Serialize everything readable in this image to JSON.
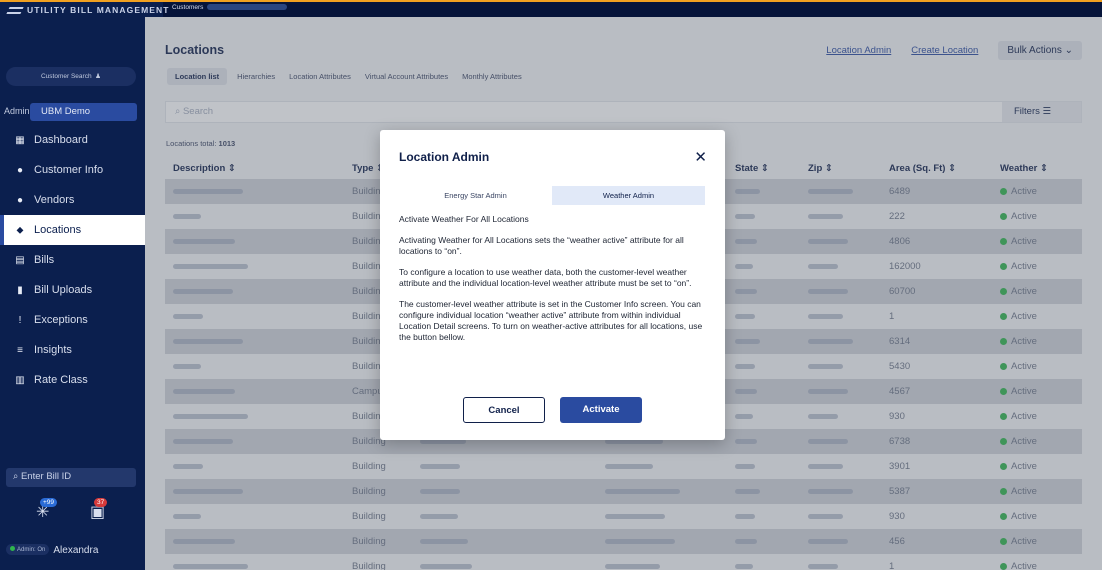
{
  "app": {
    "brand": "UTILITY BILL MANAGEMENT",
    "breadcrumb_root": "Customers"
  },
  "sidebar": {
    "customer_search": "Customer Search",
    "admin_label": "Admin",
    "customer_name": "UBM Demo",
    "items": [
      {
        "label": "Dashboard",
        "icon": "dashboard-icon",
        "glyph": "▦"
      },
      {
        "label": "Customer Info",
        "icon": "person-icon",
        "glyph": "●"
      },
      {
        "label": "Vendors",
        "icon": "vendor-icon",
        "glyph": "●"
      },
      {
        "label": "Locations",
        "icon": "location-pin-icon",
        "glyph": "⬥"
      },
      {
        "label": "Bills",
        "icon": "bill-icon",
        "glyph": "▤"
      },
      {
        "label": "Bill Uploads",
        "icon": "upload-icon",
        "glyph": "▮"
      },
      {
        "label": "Exceptions",
        "icon": "alert-icon",
        "glyph": "!"
      },
      {
        "label": "Insights",
        "icon": "insights-icon",
        "glyph": "≡"
      },
      {
        "label": "Rate Class",
        "icon": "rate-class-icon",
        "glyph": "▥"
      }
    ],
    "active_index": 3,
    "bill_id_placeholder": "Enter Bill ID",
    "badge_one": "+99",
    "badge_two": "37",
    "admin_on": "Admin: On",
    "user_name": "Alexandra"
  },
  "header": {
    "title": "Locations",
    "links": [
      "Location Admin",
      "Create Location"
    ],
    "bulk_actions": "Bulk Actions"
  },
  "tabs": [
    "Location list",
    "Hierarchies",
    "Location Attributes",
    "Virtual Account Attributes",
    "Monthly Attributes"
  ],
  "search": {
    "placeholder": "Search",
    "filters": "Filters"
  },
  "total_label": "Locations total:",
  "total_value": "1013",
  "table": {
    "columns": [
      "Description ⇕",
      "Type ⇕",
      "",
      "",
      "State ⇕",
      "Zip ⇕",
      "Area (Sq. Ft) ⇕",
      "Weather ⇕"
    ],
    "rows": [
      {
        "type": "Building",
        "area": "6489",
        "weather": "Active"
      },
      {
        "type": "Building",
        "area": "222",
        "weather": "Active"
      },
      {
        "type": "Building",
        "area": "4806",
        "weather": "Active"
      },
      {
        "type": "Building",
        "area": "162000",
        "weather": "Active"
      },
      {
        "type": "Building",
        "area": "60700",
        "weather": "Active"
      },
      {
        "type": "Building",
        "area": "1",
        "weather": "Active"
      },
      {
        "type": "Building",
        "area": "6314",
        "weather": "Active"
      },
      {
        "type": "Building",
        "area": "5430",
        "weather": "Active"
      },
      {
        "type": "Campus",
        "area": "4567",
        "weather": "Active"
      },
      {
        "type": "Building",
        "area": "930",
        "weather": "Active"
      },
      {
        "type": "Building",
        "area": "6738",
        "weather": "Active"
      },
      {
        "type": "Building",
        "area": "3901",
        "weather": "Active"
      },
      {
        "type": "Building",
        "area": "5387",
        "weather": "Active"
      },
      {
        "type": "Building",
        "area": "930",
        "weather": "Active"
      },
      {
        "type": "Building",
        "area": "456",
        "weather": "Active"
      },
      {
        "type": "Building",
        "area": "1",
        "weather": "Active"
      }
    ]
  },
  "modal": {
    "title": "Location Admin",
    "close_icon": "close-icon",
    "tabs": [
      "Energy Star Admin",
      "Weather Admin"
    ],
    "active_tab": 1,
    "heading": "Activate Weather For All Locations",
    "paragraphs": [
      "Activating Weather for All Locations sets the “weather active” attribute for all locations to “on”.",
      "To configure a location to use weather data, both the customer-level weather attribute and the individual location-level weather attribute must be set to “on”.",
      "The customer-level weather attribute is set in the Customer Info screen. You can configure individual location “weather active” attribute from within individual Location Detail screens. To turn on weather-active attributes for all locations, use the button bellow."
    ],
    "cancel": "Cancel",
    "activate": "Activate"
  },
  "colors": {
    "sidebar_bg": "#0b1f4e",
    "accent": "#2a4ba0",
    "active_green": "#2fb54d",
    "annotation_arrow": "#6fad3d"
  }
}
